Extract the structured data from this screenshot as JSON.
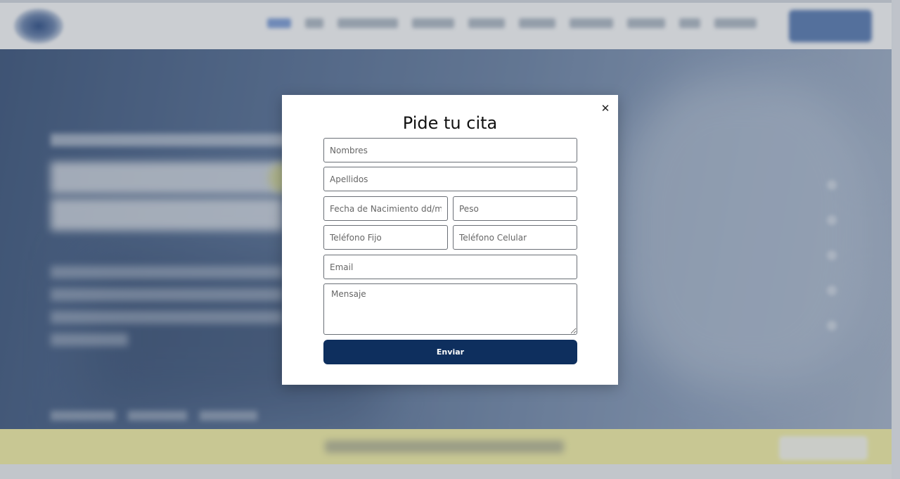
{
  "modal": {
    "title": "Pide tu cita",
    "close_icon": "close-icon",
    "close_glyph": "✕",
    "fields": {
      "nombres": {
        "placeholder": "Nombres",
        "value": ""
      },
      "apellidos": {
        "placeholder": "Apellidos",
        "value": ""
      },
      "fecha_nacimiento": {
        "placeholder": "Fecha de Nacimiento dd/mm",
        "value": ""
      },
      "peso": {
        "placeholder": "Peso",
        "value": ""
      },
      "telefono_fijo": {
        "placeholder": "Teléfono Fijo",
        "value": ""
      },
      "telefono_celular": {
        "placeholder": "Teléfono Celular",
        "value": ""
      },
      "email": {
        "placeholder": "Email",
        "value": ""
      },
      "mensaje": {
        "placeholder": "Mensaje",
        "value": ""
      }
    },
    "submit_label": "Enviar"
  },
  "colors": {
    "submit_button": "#0e2f5e",
    "banner": "#fbf6a8",
    "nav_active": "#3e6fc8"
  }
}
